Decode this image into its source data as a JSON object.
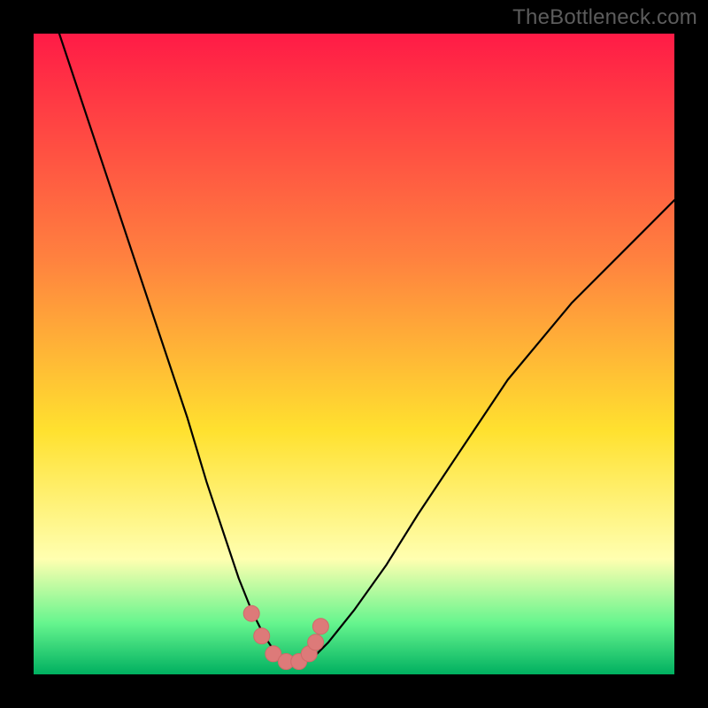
{
  "watermark": {
    "text": "TheBottleneck.com"
  },
  "colors": {
    "black": "#000000",
    "curve": "#000000",
    "marker_fill": "#dd7a79",
    "marker_stroke": "#cf6a69",
    "gradient": {
      "top": "#ff1b46",
      "upper_mid": "#ff813f",
      "mid": "#ffe12f",
      "pale": "#ffffb0",
      "base_top": "#66f58e",
      "base_bot": "#00b060"
    }
  },
  "chart_data": {
    "type": "line",
    "title": "",
    "xlabel": "",
    "ylabel": "",
    "xlim": [
      0,
      100
    ],
    "ylim": [
      0,
      100
    ],
    "grid": false,
    "legend": false,
    "annotations": [
      "TheBottleneck.com"
    ],
    "note": "Axes are unlabeled; x/y are normalised 0–100 percentages estimated from pixel position. Curve shows bottleneck mismatch magnitude (high=red, low=green) vs component balance; minimum near x≈40.",
    "series": [
      {
        "name": "bottleneck-curve",
        "x": [
          4,
          8,
          12,
          16,
          20,
          24,
          27,
          30,
          32,
          34,
          36,
          38,
          40,
          42,
          44,
          46,
          50,
          55,
          60,
          66,
          74,
          84,
          94,
          100
        ],
        "y": [
          100,
          88,
          76,
          64,
          52,
          40,
          30,
          21,
          15,
          10,
          6,
          3,
          2,
          2,
          3,
          5,
          10,
          17,
          25,
          34,
          46,
          58,
          68,
          74
        ]
      },
      {
        "name": "optimal-markers",
        "x": [
          34.0,
          35.6,
          37.4,
          39.4,
          41.4,
          43.0,
          44.0,
          44.8
        ],
        "y": [
          9.5,
          6.0,
          3.2,
          2.0,
          2.0,
          3.2,
          5.0,
          7.5
        ]
      }
    ],
    "background_gradient_stops": [
      {
        "pct": 0,
        "color": "#ff1b46"
      },
      {
        "pct": 35,
        "color": "#ff813f"
      },
      {
        "pct": 62,
        "color": "#ffe12f"
      },
      {
        "pct": 82,
        "color": "#ffffb0"
      },
      {
        "pct": 92,
        "color": "#66f58e"
      },
      {
        "pct": 100,
        "color": "#00b060"
      }
    ]
  }
}
